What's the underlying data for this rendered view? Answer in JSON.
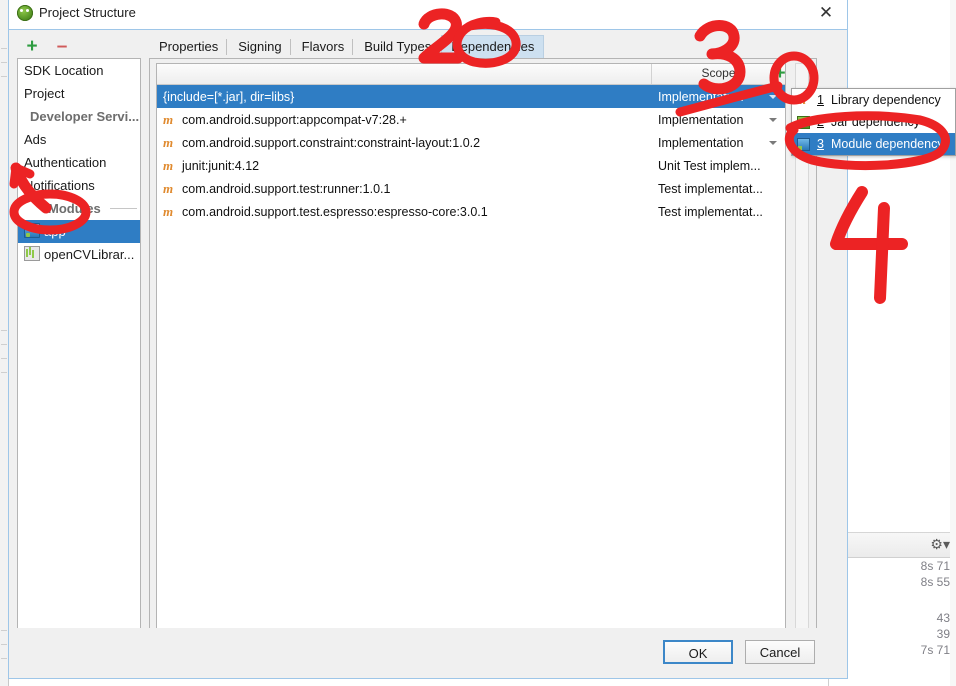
{
  "window": {
    "title": "Project Structure",
    "icon": "android-studio-icon",
    "close_label": "✕"
  },
  "sidebar": {
    "toolbar": {
      "add_label": "+",
      "remove_label": "–"
    },
    "items": [
      {
        "label": "SDK Location",
        "type": "item"
      },
      {
        "label": "Project",
        "type": "item"
      },
      {
        "label": "Developer Servi...",
        "type": "group"
      },
      {
        "label": "Ads",
        "type": "item"
      },
      {
        "label": "Authentication",
        "type": "item"
      },
      {
        "label": "Notifications",
        "type": "item"
      },
      {
        "label": "Modules",
        "type": "separator"
      },
      {
        "label": "app",
        "type": "module",
        "icon": "app-module-icon",
        "selected": true
      },
      {
        "label": "openCVLibrar...",
        "type": "module",
        "icon": "library-module-icon",
        "selected": false
      }
    ]
  },
  "tabs": [
    {
      "label": "Properties",
      "active": false
    },
    {
      "label": "Signing",
      "active": false
    },
    {
      "label": "Flavors",
      "active": false
    },
    {
      "label": "Build Types",
      "active": false
    },
    {
      "label": "Dependencies",
      "active": true
    }
  ],
  "dependencies_table": {
    "columns": [
      "",
      "Scope"
    ],
    "add_button_label": "+",
    "rows": [
      {
        "name": "{include=[*.jar], dir=libs}",
        "scope": "Implementation",
        "icon": "none",
        "selected": true
      },
      {
        "name": "com.android.support:appcompat-v7:28.+",
        "scope": "Implementation",
        "icon": "maven-icon",
        "selected": false
      },
      {
        "name": "com.android.support.constraint:constraint-layout:1.0.2",
        "scope": "Implementation",
        "icon": "maven-icon",
        "selected": false
      },
      {
        "name": "junit:junit:4.12",
        "scope": "Unit Test implem...",
        "icon": "maven-icon",
        "selected": false
      },
      {
        "name": "com.android.support.test:runner:1.0.1",
        "scope": "Test implementat...",
        "icon": "maven-icon",
        "selected": false
      },
      {
        "name": "com.android.support.test.espresso:espresso-core:3.0.1",
        "scope": "Test implementat...",
        "icon": "maven-icon",
        "selected": false
      }
    ]
  },
  "add_dependency_menu": {
    "items": [
      {
        "num": "1",
        "label": "Library dependency",
        "icon": "maven-icon",
        "selected": false
      },
      {
        "num": "2",
        "label": "Jar dependency",
        "icon": "jar-icon",
        "selected": false
      },
      {
        "num": "3",
        "label": "Module dependency",
        "icon": "module-icon",
        "selected": true
      }
    ]
  },
  "footer": {
    "ok_label": "OK",
    "cancel_label": "Cancel"
  },
  "annotations": {
    "color": "#ec2324",
    "marks": [
      {
        "label": "1",
        "kind": "arrow-circle",
        "target": "sidebar-item-app"
      },
      {
        "label": "2",
        "kind": "digit-circle",
        "target": "tab-dependencies"
      },
      {
        "label": "3",
        "kind": "digit-circle",
        "target": "add-dependency-button"
      },
      {
        "label": "4",
        "kind": "digit",
        "target": "module-dependency-menu-item"
      }
    ]
  },
  "background": {
    "gear_icon": "gear-icon",
    "rows": [
      "8s 71",
      "8s 55",
      "",
      "43",
      "39",
      "7s 71"
    ]
  }
}
